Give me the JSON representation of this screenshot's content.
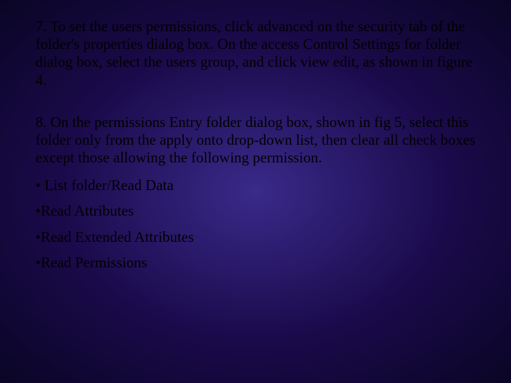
{
  "paragraphs": {
    "step7": "7. To set the users permissions, click advanced on the security tab of the folder's properties dialog box. On the access Control Settings for folder dialog box, select the users group, and click view edit, as shown in figure 4.",
    "step8": "8. On the permissions Entry folder dialog box, shown in fig 5, select this folder only from the apply onto drop-down list, then clear all check boxes except those allowing the following permission."
  },
  "bullets": [
    " List folder/Read Data",
    "Read Attributes",
    "Read Extended Attributes",
    "Read Permissions"
  ]
}
